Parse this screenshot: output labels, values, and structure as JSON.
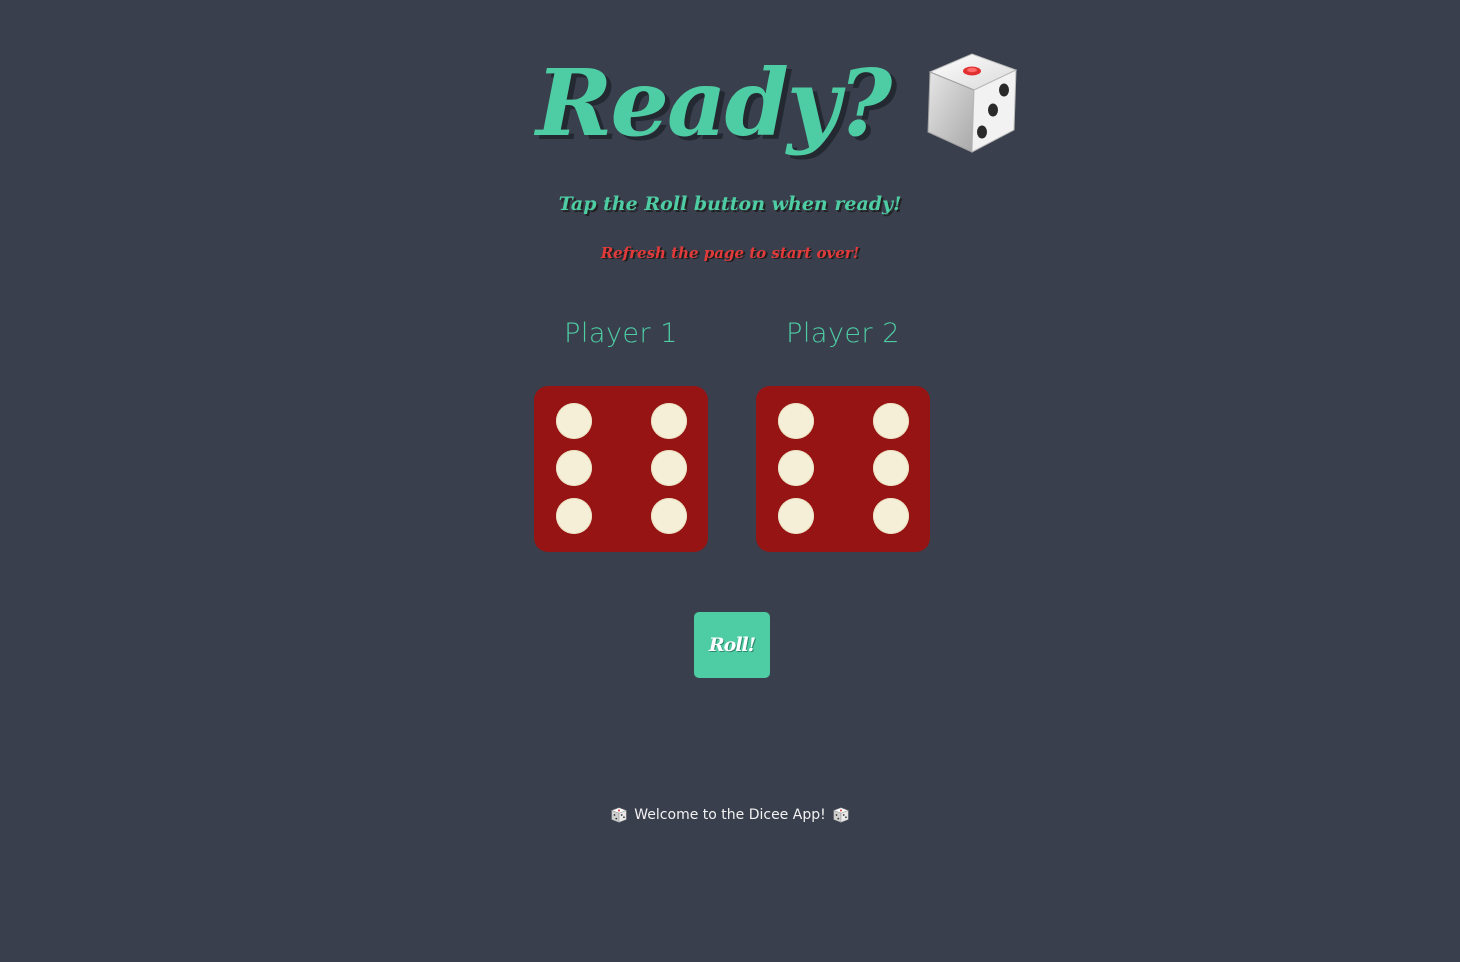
{
  "header": {
    "title": "Ready?",
    "title_icon": "dice-icon",
    "subtitle": "Tap the Roll button when ready!",
    "refresh_notice": "Refresh the page to start over!"
  },
  "players": [
    {
      "label": "Player 1",
      "die_value": 6
    },
    {
      "label": "Player 2",
      "die_value": 6
    }
  ],
  "roll_button": {
    "label": "Roll!"
  },
  "footer": {
    "text": "Welcome to the Dicee App!",
    "icon": "dice-icon"
  },
  "colors": {
    "background": "#393f4d",
    "accent": "#4ecca3",
    "warning": "#e23a3a",
    "die_red": "#971414",
    "pip": "#f6efd8"
  }
}
